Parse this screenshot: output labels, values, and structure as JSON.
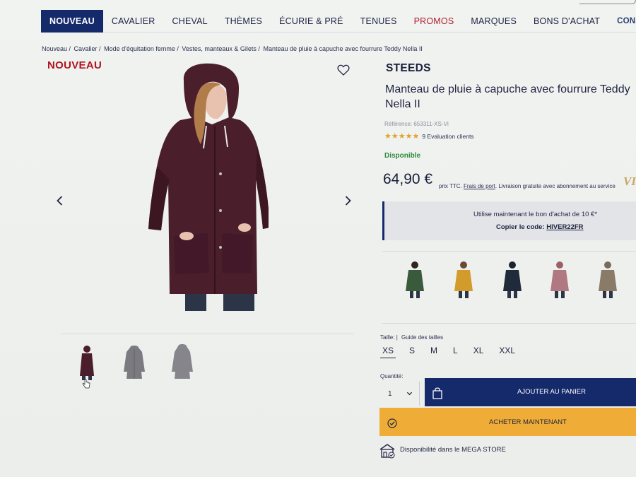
{
  "nav": {
    "items": [
      {
        "label": "NOUVEAU",
        "active": true
      },
      {
        "label": "CAVALIER"
      },
      {
        "label": "CHEVAL"
      },
      {
        "label": "THÈMES"
      },
      {
        "label": "ÉCURIE & PRÉ"
      },
      {
        "label": "TENUES"
      },
      {
        "label": "PROMOS",
        "accent": "#b01e2e"
      },
      {
        "label": "MARQUES"
      },
      {
        "label": "BONS D'ACHAT"
      }
    ],
    "conseils": "CONSEILS"
  },
  "breadcrumb": [
    "Nouveau /",
    "Cavalier /",
    "Mode d'équitation femme /",
    "Vestes, manteaux & Gilets /",
    "Manteau de pluie à capuche avec fourrure Teddy Nella II"
  ],
  "product": {
    "badge": "NOUVEAU",
    "brand": "STEEDS",
    "title": "Manteau de pluie à capuche avec fourrure Teddy Nella II",
    "reference": "Référence: 653311-XS-VI",
    "rating": {
      "stars": "★★★★★",
      "value": 5,
      "max": 5,
      "count_label": "9 Evaluation clients"
    },
    "availability": "Disponible",
    "price": "64,90 €",
    "price_note_prefix": "prix TTC.",
    "price_note_link": "Frais de port",
    "price_note_suffix": ". Livraison gratuite avec abonnement au service",
    "vip_logo": "VI"
  },
  "voucher": {
    "line1": "Utilise maintenant le bon d'achat de 10 €*",
    "line2_prefix": "Copier le code:",
    "code": "HIVER22FR"
  },
  "color_variants": [
    {
      "color": "green",
      "hex": "#3a5a3c"
    },
    {
      "color": "mustard",
      "hex": "#d39a2c"
    },
    {
      "color": "navy",
      "hex": "#1f2b3a"
    },
    {
      "color": "rose",
      "hex": "#b07880"
    },
    {
      "color": "taupe",
      "hex": "#8a7a68"
    }
  ],
  "sizes": {
    "label": "Taille:",
    "separator": "|",
    "guide": "Guide des tailles",
    "options": [
      "XS",
      "S",
      "M",
      "L",
      "XL",
      "XXL"
    ],
    "selected": "XS"
  },
  "quantity": {
    "label": "Quantité:",
    "value": "1"
  },
  "buttons": {
    "add_to_cart": "AJOUTER AU PANIER",
    "buy_now": "ACHETER MAINTENANT"
  },
  "store": {
    "text": "Disponibilité dans le MEGA STORE"
  },
  "colors": {
    "primary": "#142a6b",
    "accent_red": "#b0131f",
    "buy_now": "#efad37",
    "available_green": "#2d8a3c",
    "star": "#e0a32c",
    "coat_main": "#4a1e2a"
  }
}
